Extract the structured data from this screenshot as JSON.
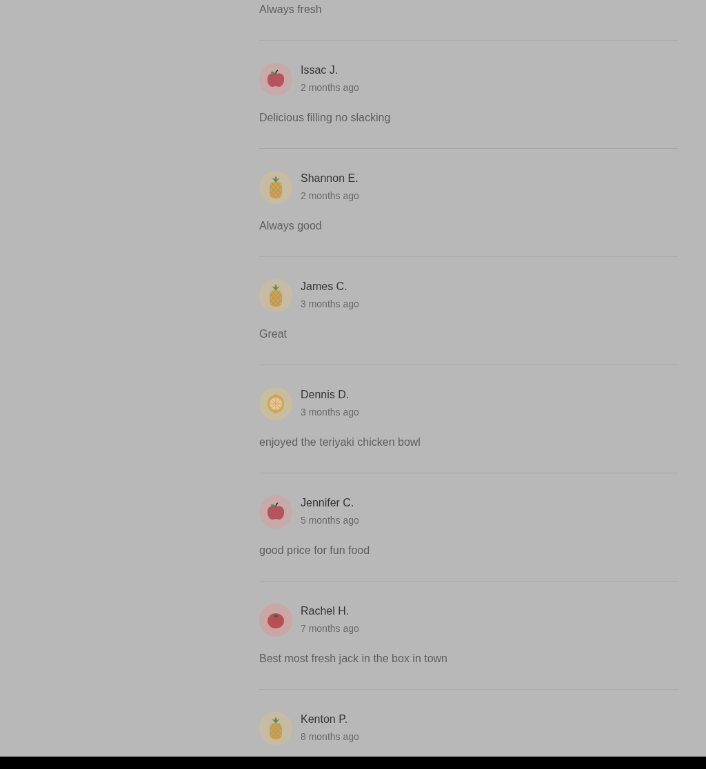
{
  "reviews": [
    {
      "comment": "Always fresh"
    },
    {
      "author": "Issac J.",
      "avatar": {
        "kind": "apple"
      },
      "time": "2 months ago",
      "comment": "Delicious filling no slacking"
    },
    {
      "author": "Shannon E.",
      "avatar": {
        "kind": "pineapple"
      },
      "time": "2 months ago",
      "comment": "Always good"
    },
    {
      "author": "James C.",
      "avatar": {
        "kind": "pineapple"
      },
      "time": "3 months ago",
      "comment": "Great"
    },
    {
      "author": "Dennis D.",
      "avatar": {
        "kind": "lemon"
      },
      "time": "3 months ago",
      "comment": "enjoyed the teriyaki chicken bowl"
    },
    {
      "author": "Jennifer C.",
      "avatar": {
        "kind": "apple"
      },
      "time": "5 months ago",
      "comment": "good price for fun food"
    },
    {
      "author": "Rachel H.",
      "avatar": {
        "kind": "tomato"
      },
      "time": "7 months ago",
      "comment": "Best most fresh jack in the box in town"
    },
    {
      "author": "Kenton P.",
      "avatar": {
        "kind": "pineapple"
      },
      "time": "8 months ago"
    }
  ]
}
